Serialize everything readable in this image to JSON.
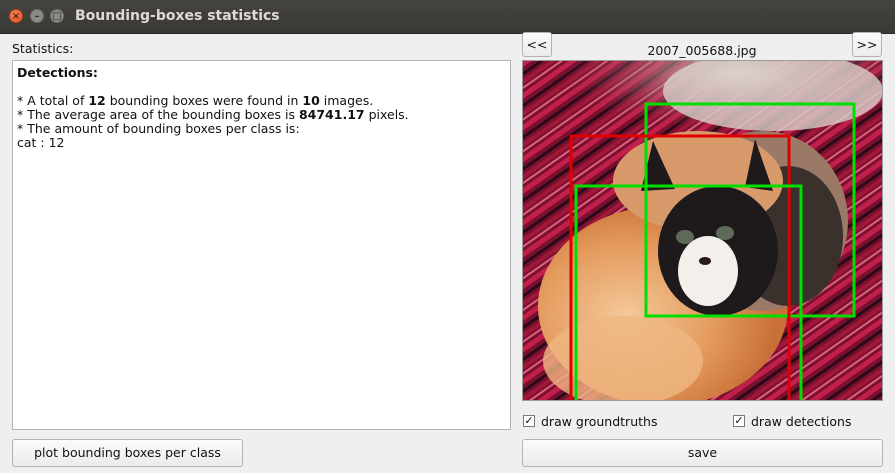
{
  "window": {
    "title": "Bounding-boxes statistics"
  },
  "stats": {
    "label": "Statistics:",
    "heading": "Detections:",
    "line1": {
      "prefix": "* A total of ",
      "boxes": "12",
      "mid": " bounding boxes were found in ",
      "images": "10",
      "suffix": " images."
    },
    "line2": {
      "prefix": "* The average area of the bounding boxes is ",
      "area": "84741.17",
      "suffix": " pixels."
    },
    "line3": "* The amount of bounding boxes per class is:",
    "line4": "cat : 12"
  },
  "nav": {
    "prev_label": "<<",
    "next_label": ">>",
    "filename": "2007_005688.jpg"
  },
  "options": {
    "groundtruths_label": "draw groundtruths",
    "detections_label": "draw detections",
    "groundtruths_checked": true,
    "detections_checked": true
  },
  "buttons": {
    "plot_label": "plot bounding boxes per class",
    "save_label": "save"
  },
  "colors": {
    "groundtruth_box": "#00e000",
    "detection_box": "#e00000",
    "titlebar": "#3c3b37"
  }
}
